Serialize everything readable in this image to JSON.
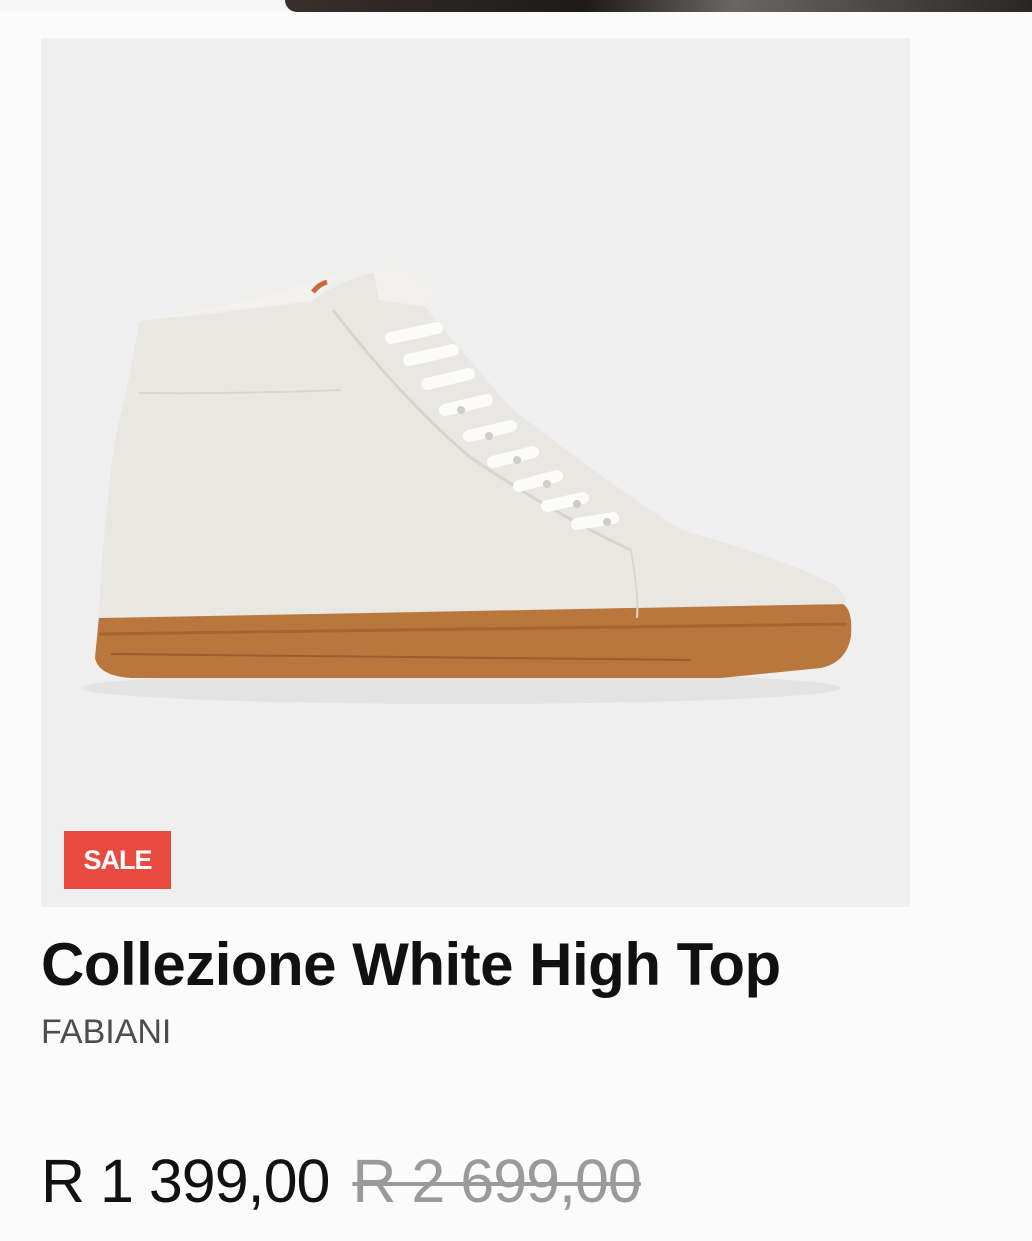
{
  "product": {
    "badge": "SALE",
    "title": "Collezione White High Top",
    "brand": "FABIANI",
    "price_current": "R 1 399,00",
    "price_original": "R 2 699,00",
    "image_icon": "sneaker-image"
  },
  "colors": {
    "badge_bg": "#e84a3f",
    "card_bg": "#efefef",
    "title": "#111111",
    "brand": "#4d4d4d",
    "original_price": "#9a9a9a"
  }
}
